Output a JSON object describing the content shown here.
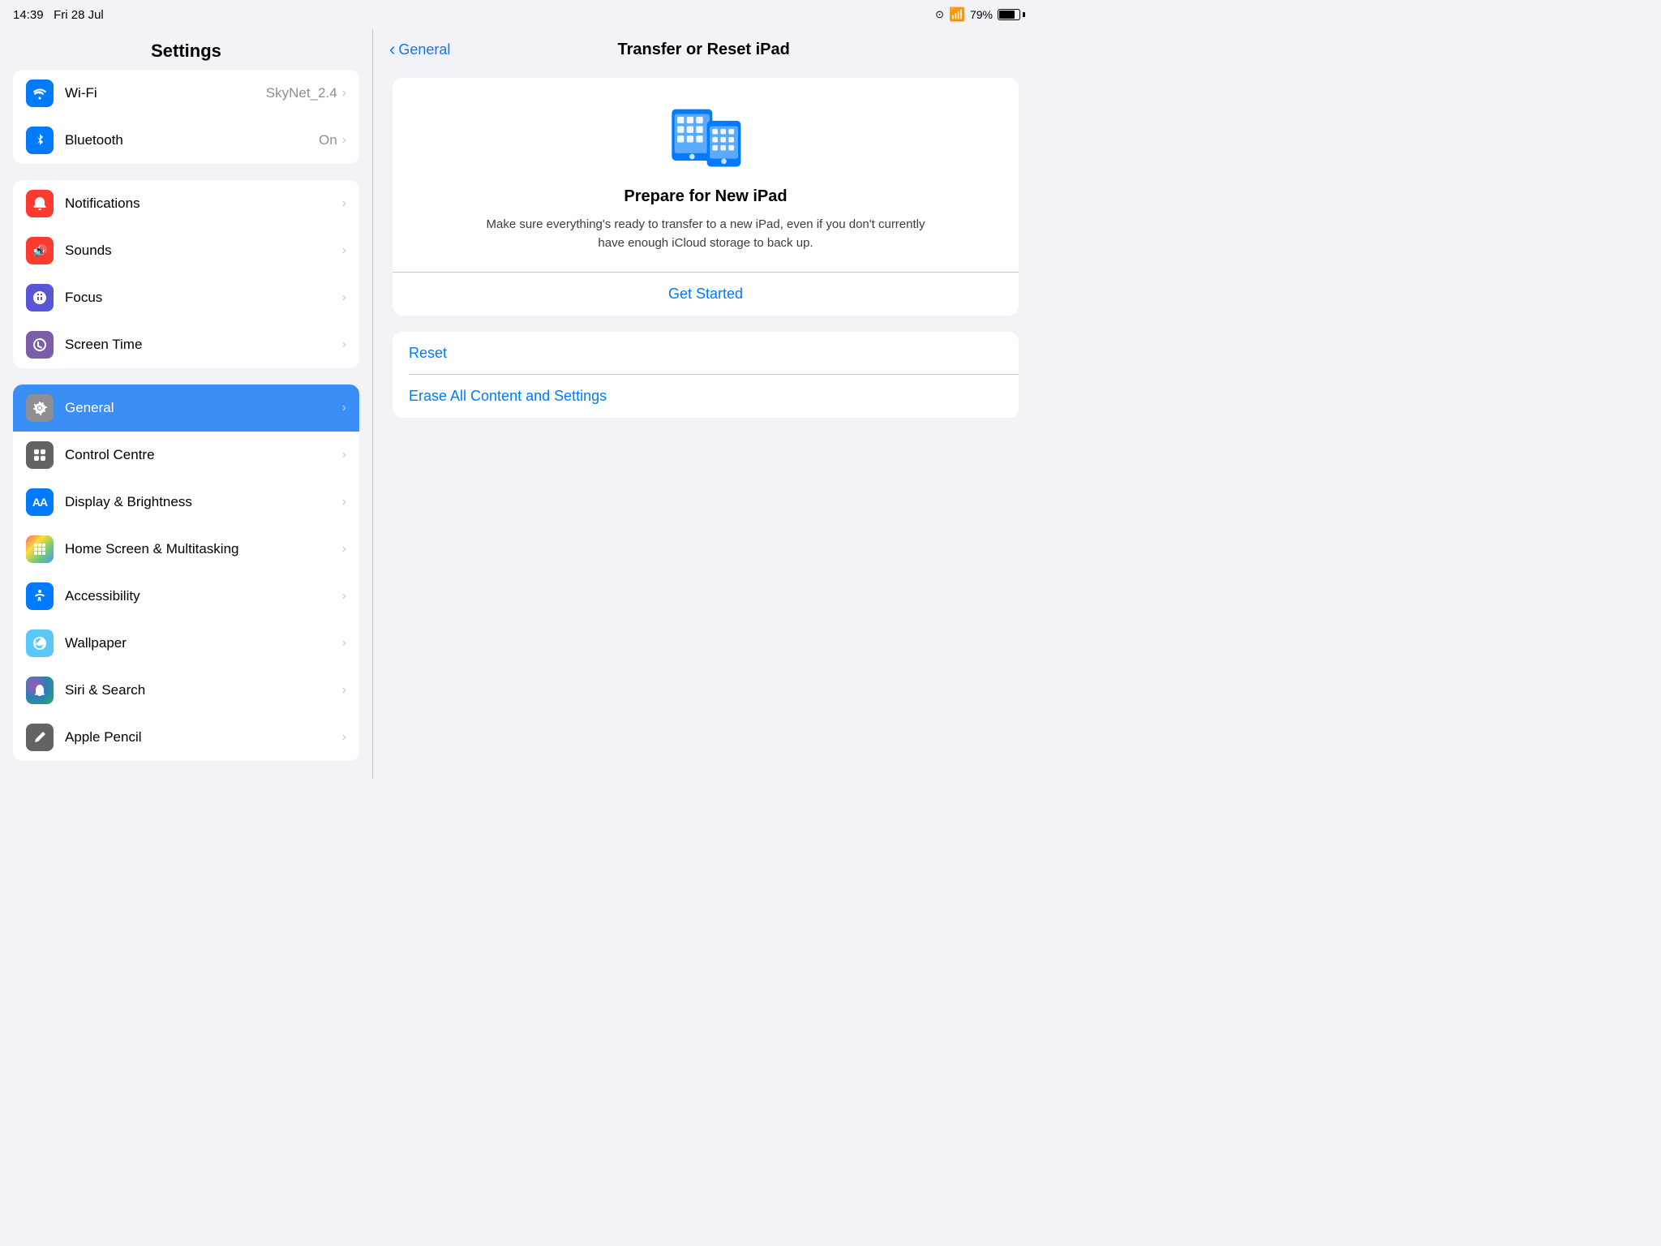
{
  "statusBar": {
    "time": "14:39",
    "date": "Fri 28 Jul",
    "wifi": "Wi-Fi",
    "battery": "79%",
    "batteryLevel": 79
  },
  "sidebar": {
    "title": "Settings",
    "groups": [
      {
        "id": "connectivity",
        "items": [
          {
            "id": "wifi",
            "label": "Wi-Fi",
            "value": "SkyNet_2.4",
            "icon": "wifi",
            "iconBg": "bg-blue"
          },
          {
            "id": "bluetooth",
            "label": "Bluetooth",
            "value": "On",
            "icon": "bluetooth",
            "iconBg": "bg-blue"
          }
        ]
      },
      {
        "id": "notifications",
        "items": [
          {
            "id": "notifications",
            "label": "Notifications",
            "value": "",
            "icon": "bell",
            "iconBg": "bg-red"
          },
          {
            "id": "sounds",
            "label": "Sounds",
            "value": "",
            "icon": "speaker",
            "iconBg": "bg-red"
          },
          {
            "id": "focus",
            "label": "Focus",
            "value": "",
            "icon": "moon",
            "iconBg": "bg-purple"
          },
          {
            "id": "screentime",
            "label": "Screen Time",
            "value": "",
            "icon": "hourglass",
            "iconBg": "bg-purple2"
          }
        ]
      },
      {
        "id": "general-group",
        "items": [
          {
            "id": "general",
            "label": "General",
            "value": "",
            "icon": "gear",
            "iconBg": "bg-gray",
            "active": true
          },
          {
            "id": "controlcentre",
            "label": "Control Centre",
            "value": "",
            "icon": "sliders",
            "iconBg": "bg-gray2"
          },
          {
            "id": "displaybrightness",
            "label": "Display & Brightness",
            "value": "",
            "icon": "AA",
            "iconBg": "bg-blue"
          },
          {
            "id": "homescreen",
            "label": "Home Screen & Multitasking",
            "value": "",
            "icon": "grid",
            "iconBg": "bg-colorful"
          },
          {
            "id": "accessibility",
            "label": "Accessibility",
            "value": "",
            "icon": "person",
            "iconBg": "bg-blue"
          },
          {
            "id": "wallpaper",
            "label": "Wallpaper",
            "value": "",
            "icon": "flower",
            "iconBg": "bg-teal"
          },
          {
            "id": "sirisearch",
            "label": "Siri & Search",
            "value": "",
            "icon": "siri",
            "iconBg": "bg-siri"
          },
          {
            "id": "applepencil",
            "label": "Apple Pencil",
            "value": "",
            "icon": "pencil",
            "iconBg": "bg-gray2"
          }
        ]
      }
    ]
  },
  "rightPanel": {
    "navBack": "General",
    "navTitle": "Transfer or Reset iPad",
    "prepareCard": {
      "title": "Prepare for New iPad",
      "description": "Make sure everything's ready to transfer to a new iPad, even if you don't currently have enough iCloud storage to back up.",
      "getStartedLabel": "Get Started"
    },
    "bottomActions": [
      {
        "id": "reset",
        "label": "Reset"
      },
      {
        "id": "eraseall",
        "label": "Erase All Content and Settings"
      }
    ]
  }
}
